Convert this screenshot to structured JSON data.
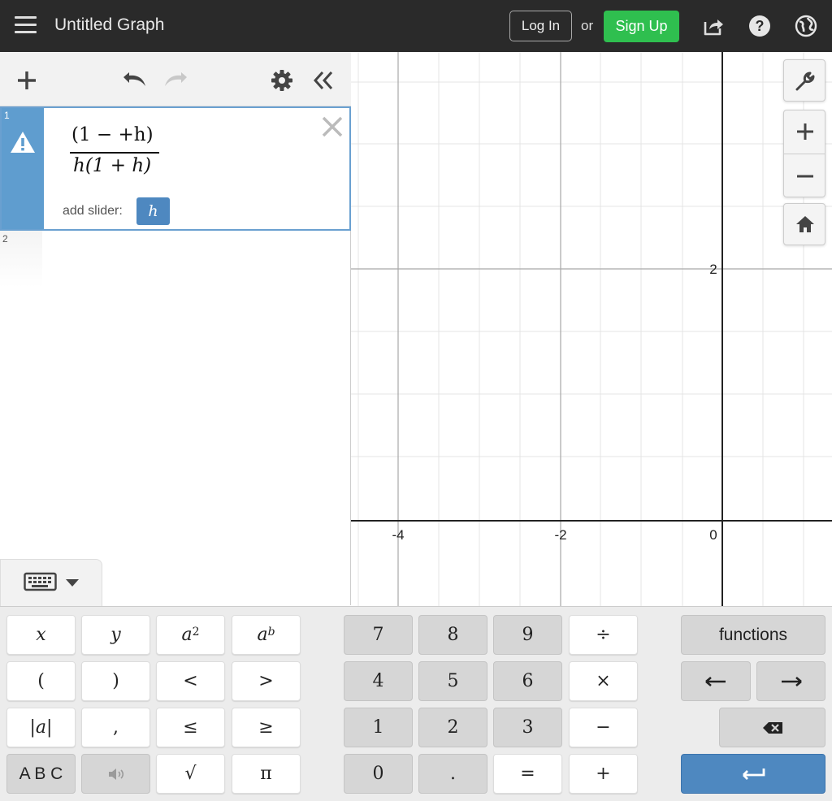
{
  "header": {
    "title": "Untitled Graph",
    "login_label": "Log In",
    "or_label": "or",
    "signup_label": "Sign Up",
    "signup_color": "#2fbf4f"
  },
  "expressions": [
    {
      "index": "1",
      "numerator": "(1 − +h)",
      "denominator": "h(1 + h)",
      "slider_prompt": "add slider:",
      "slider_variable": "h",
      "status": "warning-icon"
    },
    {
      "index": "2"
    }
  ],
  "graph": {
    "x_labels": [
      "-4",
      "-2",
      "0"
    ],
    "y_labels": [
      "2"
    ]
  },
  "keypad": {
    "row1": [
      "x",
      "y",
      "a",
      "a",
      "7",
      "8",
      "9",
      "÷",
      "functions"
    ],
    "superscripts": [
      "2",
      "b"
    ],
    "row2": [
      "(",
      ")",
      "<",
      ">",
      "4",
      "5",
      "6",
      "×"
    ],
    "row3": [
      "|a|",
      ",",
      "≤",
      "≥",
      "1",
      "2",
      "3",
      "−"
    ],
    "row4": [
      "A B C",
      "√",
      "π",
      "0",
      ".",
      "=",
      "+"
    ],
    "enter_color": "#4e88c0"
  }
}
